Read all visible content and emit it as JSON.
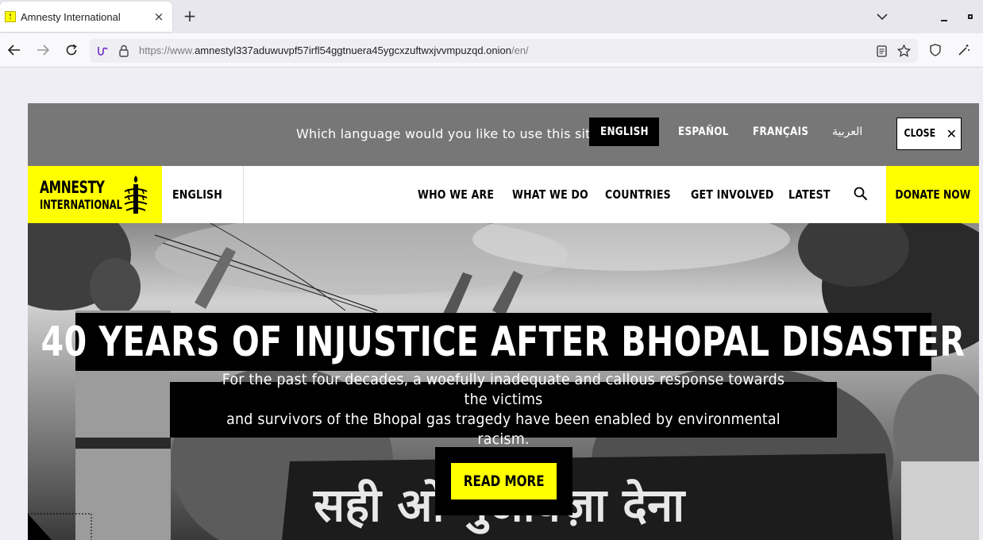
{
  "browser": {
    "tab": {
      "title": "Amnesty International",
      "favicon": "amnesty-candle-icon",
      "close_icon": "×"
    },
    "new_tab_icon": "+",
    "url": {
      "prefix": "https://www.",
      "domain": "amnestyl337aduwuvpf57irfl54ggtnuera45ygcxzuftwxjvvmpuzqd.onion",
      "path": "/en/"
    }
  },
  "language_bar": {
    "prompt": "Which language would you like to use this site in?",
    "options": [
      {
        "label": "ENGLISH",
        "active": true
      },
      {
        "label": "ESPAÑOL",
        "active": false
      },
      {
        "label": "FRANÇAIS",
        "active": false
      },
      {
        "label": "العربية",
        "active": false
      }
    ],
    "close_label": "CLOSE",
    "close_icon": "✕"
  },
  "main_nav": {
    "logo_line1": "AMNESTY",
    "logo_line2": "INTERNATIONAL",
    "language": "ENGLISH",
    "items": [
      "WHO WE ARE",
      "WHAT WE DO",
      "COUNTRIES",
      "GET INVOLVED",
      "LATEST"
    ],
    "donate_label": "DONATE NOW"
  },
  "hero": {
    "headline": "40 YEARS OF INJUSTICE AFTER BHOPAL DISASTER",
    "subheadline_line1": "For the past four decades, a woefully inadequate and callous response towards the victims",
    "subheadline_line2": "and survivors of the Bhopal gas tragedy have been enabled by environmental racism.",
    "cta_label": "READ MORE",
    "banner_text": "सही ओं मुआवज़ा देना"
  },
  "colors": {
    "brand_yellow": "#ffff00",
    "lang_bar_gray": "#777777",
    "black": "#000000"
  }
}
